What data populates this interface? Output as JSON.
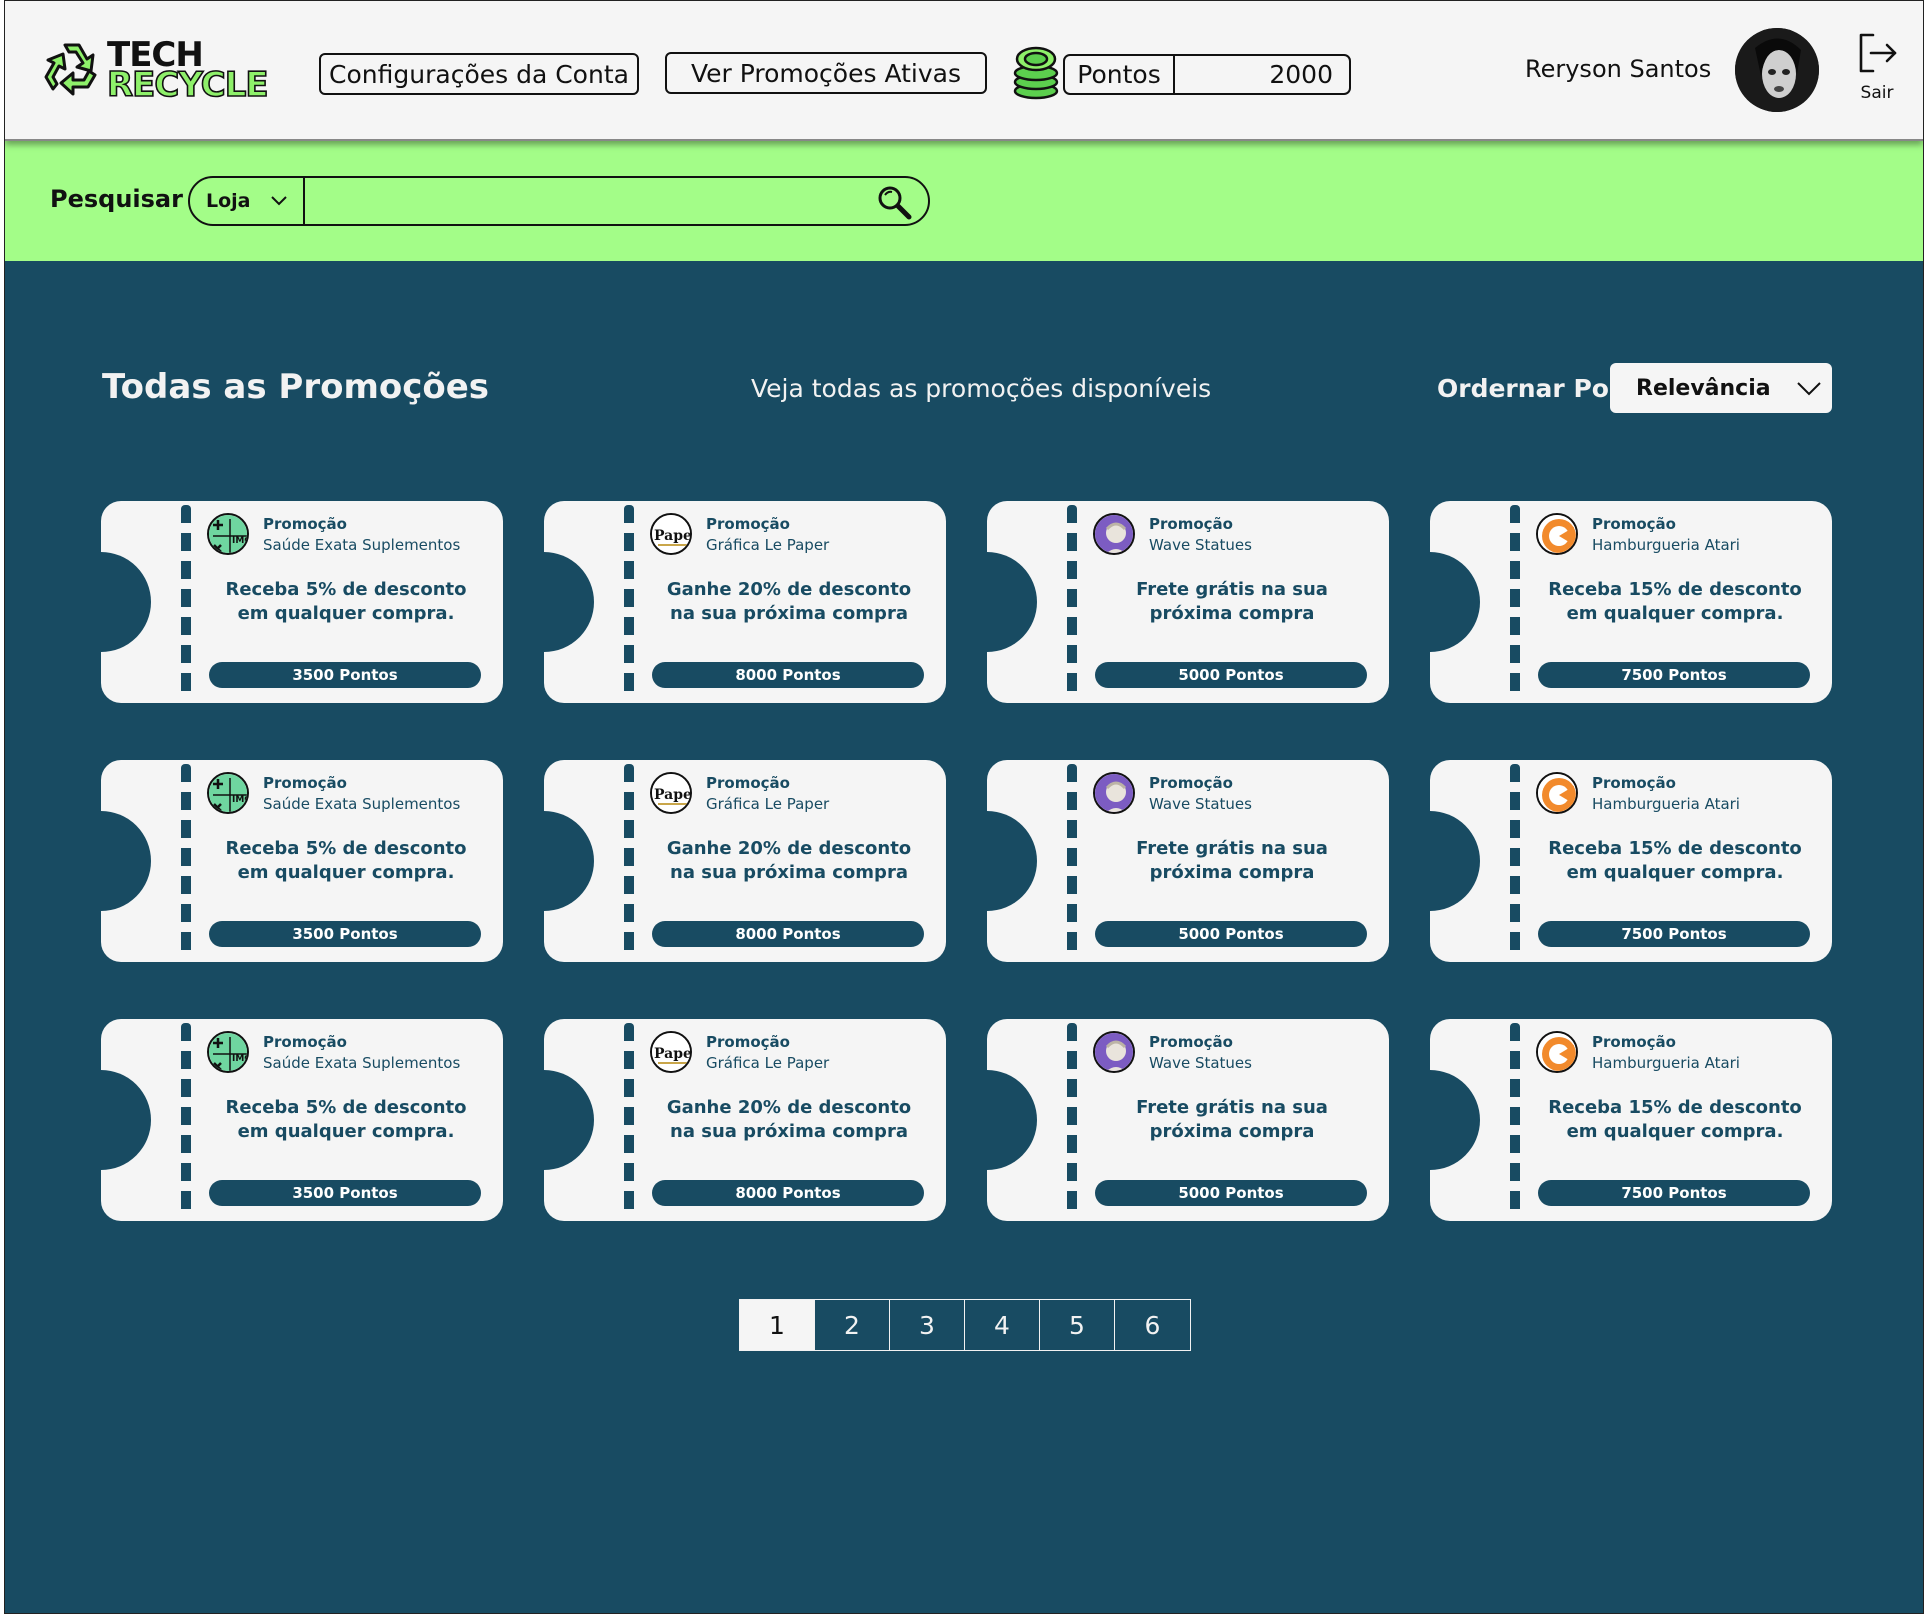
{
  "header": {
    "logo_top": "TECH",
    "logo_bottom": "RECYCLE",
    "account_button": "Configurações da Conta",
    "promotions_button": "Ver Promoções Ativas",
    "points_label": "Pontos",
    "points_value": "2000",
    "user_name": "Reryson Santos",
    "logout_label": "Sair"
  },
  "search": {
    "label": "Pesquisar",
    "filter_selected": "Loja",
    "input_value": ""
  },
  "section": {
    "title": "Todas as Promoções",
    "subtitle": "Veja todas as promoções disponíveis",
    "sort_label": "Ordernar Por",
    "sort_selected": "Relevância"
  },
  "cards": [
    {
      "tag": "Promoção",
      "store": "Saúde Exata Suplementos",
      "description": "Receba 5% de desconto em qualquer compra.",
      "points": "3500 Pontos",
      "logo": "imc-logo"
    },
    {
      "tag": "Promoção",
      "store": "Gráfica Le Paper",
      "description": "Ganhe 20% de desconto na sua próxima compra",
      "points": "8000 Pontos",
      "logo": "paper-logo"
    },
    {
      "tag": "Promoção",
      "store": "Wave Statues",
      "description": "Frete grátis na sua próxima compra",
      "points": "5000 Pontos",
      "logo": "statue-logo"
    },
    {
      "tag": "Promoção",
      "store": "Hamburgueria Atari",
      "description": "Receba 15% de desconto em qualquer compra.",
      "points": "7500 Pontos",
      "logo": "atari-logo"
    },
    {
      "tag": "Promoção",
      "store": "Saúde Exata Suplementos",
      "description": "Receba 5% de desconto em qualquer compra.",
      "points": "3500 Pontos",
      "logo": "imc-logo"
    },
    {
      "tag": "Promoção",
      "store": "Gráfica Le Paper",
      "description": "Ganhe 20% de desconto na sua próxima compra",
      "points": "8000 Pontos",
      "logo": "paper-logo"
    },
    {
      "tag": "Promoção",
      "store": "Wave Statues",
      "description": "Frete grátis na sua próxima compra",
      "points": "5000 Pontos",
      "logo": "statue-logo"
    },
    {
      "tag": "Promoção",
      "store": "Hamburgueria Atari",
      "description": "Receba 15% de desconto em qualquer compra.",
      "points": "7500 Pontos",
      "logo": "atari-logo"
    },
    {
      "tag": "Promoção",
      "store": "Saúde Exata Suplementos",
      "description": "Receba 5% de desconto em qualquer compra.",
      "points": "3500 Pontos",
      "logo": "imc-logo"
    },
    {
      "tag": "Promoção",
      "store": "Gráfica Le Paper",
      "description": "Ganhe 20% de desconto na sua próxima compra",
      "points": "8000 Pontos",
      "logo": "paper-logo"
    },
    {
      "tag": "Promoção",
      "store": "Wave Statues",
      "description": "Frete grátis na sua próxima compra",
      "points": "5000 Pontos",
      "logo": "statue-logo"
    },
    {
      "tag": "Promoção",
      "store": "Hamburgueria Atari",
      "description": "Receba 15% de desconto em qualquer compra.",
      "points": "7500 Pontos",
      "logo": "atari-logo"
    }
  ],
  "pagination": {
    "pages": [
      "1",
      "2",
      "3",
      "4",
      "5",
      "6"
    ],
    "current": "1"
  },
  "colors": {
    "primary": "#184b62",
    "accent": "#a3fd88",
    "surface": "#f5f5f5"
  }
}
